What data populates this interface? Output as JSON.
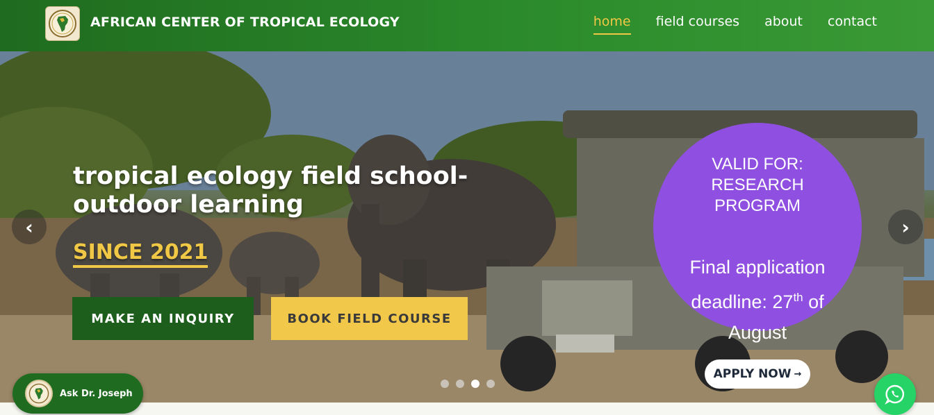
{
  "header": {
    "brand": "AFRICAN CENTER OF TROPICAL ECOLOGY",
    "logo_icon": "africa-map-logo-icon",
    "nav": [
      {
        "label": "home",
        "active": true
      },
      {
        "label": "field courses",
        "active": false
      },
      {
        "label": "about",
        "active": false
      },
      {
        "label": "contact",
        "active": false
      }
    ]
  },
  "hero": {
    "headline_line1": "tropical ecology field school-",
    "headline_line2": "outdoor learning",
    "since": "SINCE 2021",
    "inquiry_label": "MAKE AN INQUIRY",
    "book_label": "BOOK FIELD COURSE",
    "prev_glyph": "‹",
    "next_glyph": "›",
    "slide_count": 4,
    "active_slide": 3
  },
  "promo": {
    "valid_for": "VALID FOR: RESEARCH PROGRAM",
    "deadline_prefix": "Final application deadline: 27",
    "deadline_sup": "th",
    "deadline_suffix": " of August",
    "apply_label": "APPLY NOW",
    "apply_arrow": "→"
  },
  "chat": {
    "ask_label": "Ask Dr. Joseph",
    "whatsapp_icon": "whatsapp-icon"
  },
  "colors": {
    "header_green": "#2b8a2b",
    "accent_yellow": "#f0c845",
    "inquiry_green": "#1d5e1d",
    "promo_purple": "#8f4fe0",
    "whatsapp_green": "#25d366"
  }
}
